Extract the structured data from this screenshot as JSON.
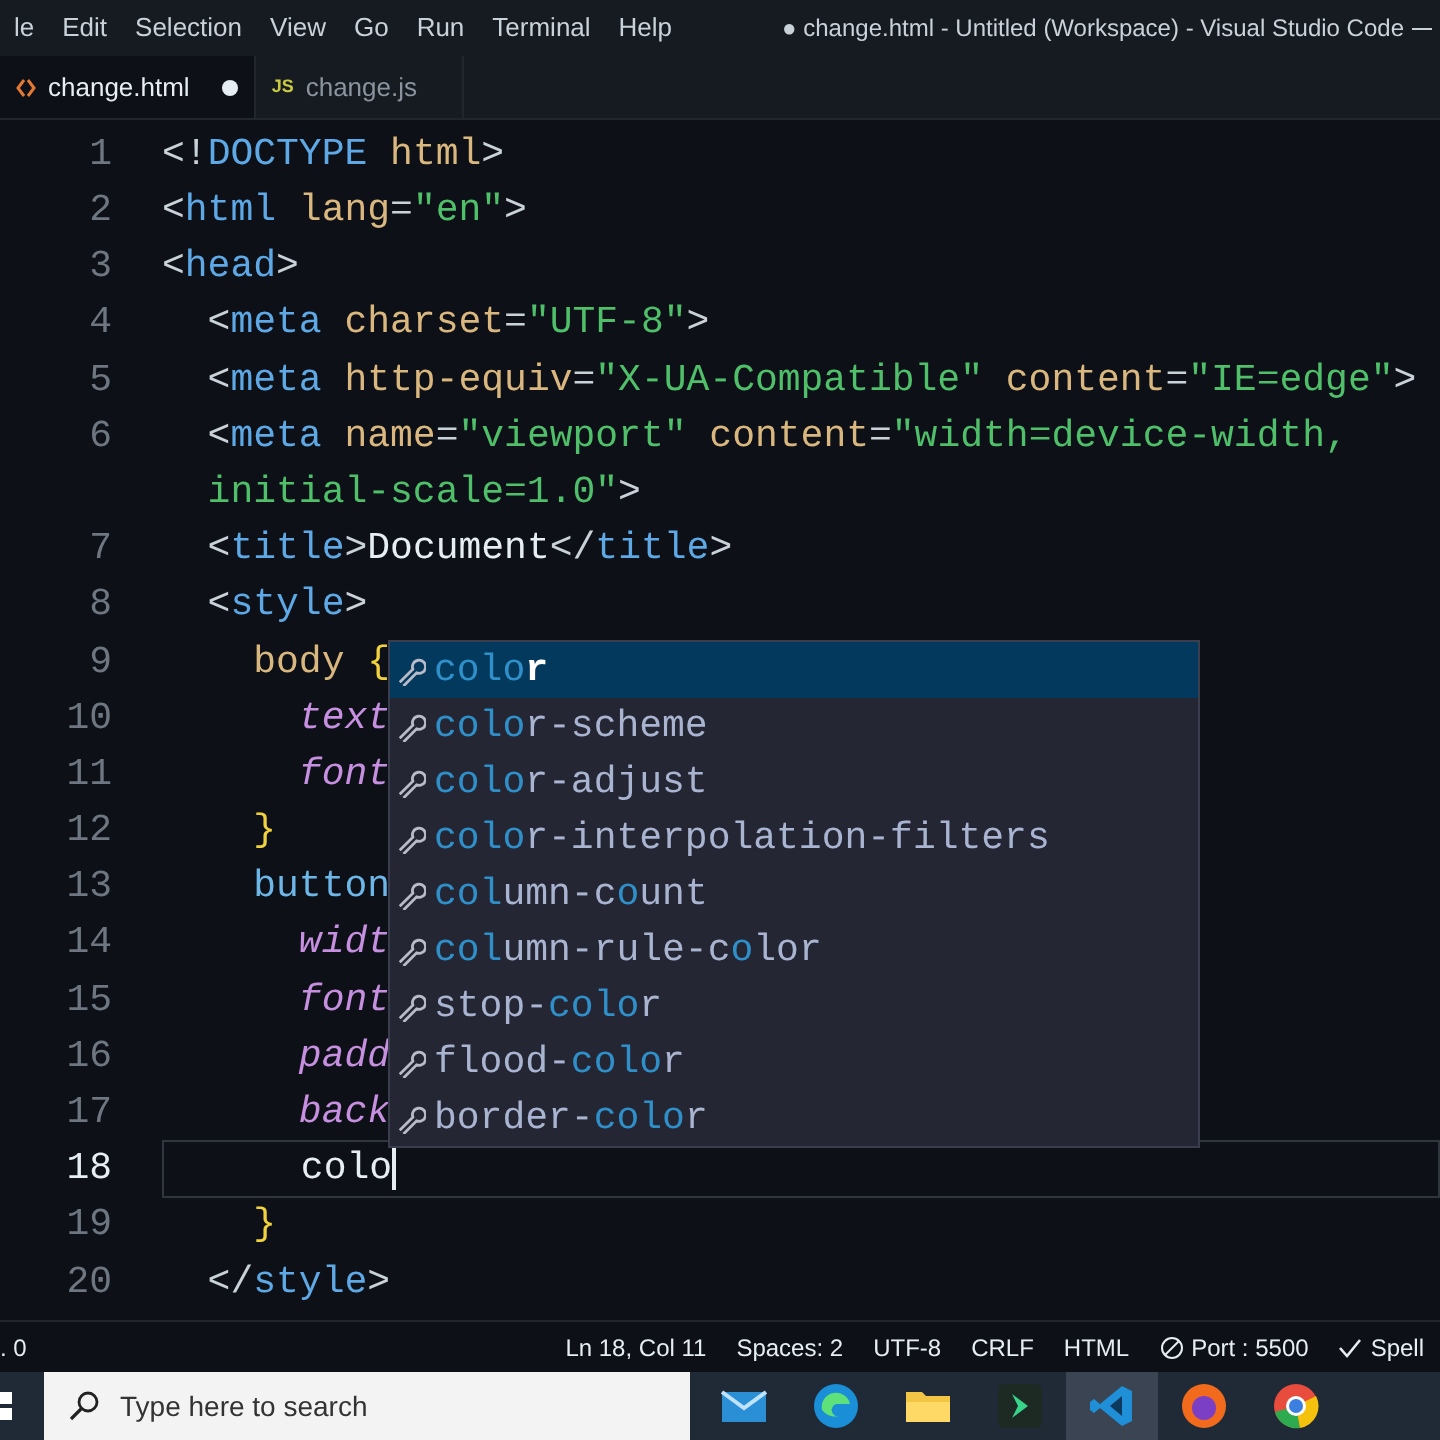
{
  "menu_bar": {
    "items": [
      "le",
      "Edit",
      "Selection",
      "View",
      "Go",
      "Run",
      "Terminal",
      "Help"
    ],
    "title": "● change.html - Untitled (Workspace) - Visual Studio Code"
  },
  "tabs": [
    {
      "label": "change.html",
      "kind": "html",
      "modified": true,
      "selected": true
    },
    {
      "label": "change.js",
      "kind": "js",
      "badge": "JS",
      "modified": false,
      "selected": false
    }
  ],
  "editor": {
    "lines": [
      {
        "number": "1",
        "current": false,
        "tokens": [
          {
            "text": "<!",
            "kind": "p"
          },
          {
            "text": "DOCTYPE",
            "kind": "tag"
          },
          {
            "text": " html",
            "kind": "attr"
          },
          {
            "text": ">",
            "kind": "p"
          }
        ]
      },
      {
        "number": "2",
        "current": false,
        "tokens": [
          {
            "text": "<",
            "kind": "p"
          },
          {
            "text": "html",
            "kind": "tag"
          },
          {
            "text": " lang",
            "kind": "attr"
          },
          {
            "text": "=",
            "kind": "p"
          },
          {
            "text": "\"en\"",
            "kind": "str"
          },
          {
            "text": ">",
            "kind": "p"
          }
        ]
      },
      {
        "number": "3",
        "current": false,
        "tokens": [
          {
            "text": "<",
            "kind": "p"
          },
          {
            "text": "head",
            "kind": "tag"
          },
          {
            "text": ">",
            "kind": "p"
          }
        ]
      },
      {
        "number": "4",
        "current": false,
        "tokens": [
          {
            "text": "  <",
            "kind": "p"
          },
          {
            "text": "meta",
            "kind": "tag"
          },
          {
            "text": " charset",
            "kind": "attr"
          },
          {
            "text": "=",
            "kind": "p"
          },
          {
            "text": "\"UTF-8\"",
            "kind": "str"
          },
          {
            "text": ">",
            "kind": "p"
          }
        ]
      },
      {
        "number": "5",
        "current": false,
        "tokens": [
          {
            "text": "  <",
            "kind": "p"
          },
          {
            "text": "meta",
            "kind": "tag"
          },
          {
            "text": " http-equiv",
            "kind": "attr"
          },
          {
            "text": "=",
            "kind": "p"
          },
          {
            "text": "\"X-UA-Compatible\"",
            "kind": "str"
          },
          {
            "text": " content",
            "kind": "attr"
          },
          {
            "text": "=",
            "kind": "p"
          },
          {
            "text": "\"IE=edge\"",
            "kind": "str"
          },
          {
            "text": ">",
            "kind": "p"
          }
        ]
      },
      {
        "number": "6",
        "current": false,
        "tokens": [
          {
            "text": "  <",
            "kind": "p"
          },
          {
            "text": "meta",
            "kind": "tag"
          },
          {
            "text": " name",
            "kind": "attr"
          },
          {
            "text": "=",
            "kind": "p"
          },
          {
            "text": "\"viewport\"",
            "kind": "str"
          },
          {
            "text": " content",
            "kind": "attr"
          },
          {
            "text": "=",
            "kind": "p"
          },
          {
            "text": "\"width=device-width,",
            "kind": "str"
          }
        ]
      },
      {
        "current": false,
        "tokens": [
          {
            "text": "  initial-scale=1.0\"",
            "kind": "str"
          },
          {
            "text": ">",
            "kind": "p"
          }
        ]
      },
      {
        "number": "7",
        "current": false,
        "tokens": [
          {
            "text": "  <",
            "kind": "p"
          },
          {
            "text": "title",
            "kind": "tag"
          },
          {
            "text": ">",
            "kind": "p"
          },
          {
            "text": "Document",
            "kind": "text"
          },
          {
            "text": "</",
            "kind": "p"
          },
          {
            "text": "title",
            "kind": "tag"
          },
          {
            "text": ">",
            "kind": "p"
          }
        ]
      },
      {
        "number": "8",
        "current": false,
        "tokens": [
          {
            "text": "  <",
            "kind": "p"
          },
          {
            "text": "style",
            "kind": "tag"
          },
          {
            "text": ">",
            "kind": "p"
          }
        ]
      },
      {
        "number": "9",
        "current": false,
        "tokens": [
          {
            "text": "    body",
            "kind": "sel"
          },
          {
            "text": " {",
            "kind": "brace"
          }
        ]
      },
      {
        "number": "10",
        "current": false,
        "tokens": [
          {
            "text": "      text",
            "kind": "prop"
          }
        ]
      },
      {
        "number": "11",
        "current": false,
        "tokens": [
          {
            "text": "      font",
            "kind": "prop"
          }
        ]
      },
      {
        "number": "12",
        "current": false,
        "tokens": [
          {
            "text": "    }",
            "kind": "brace"
          }
        ]
      },
      {
        "number": "13",
        "current": false,
        "tokens": [
          {
            "text": "    button",
            "kind": "sel2"
          }
        ]
      },
      {
        "number": "14",
        "current": false,
        "tokens": [
          {
            "text": "      widt",
            "kind": "prop"
          }
        ]
      },
      {
        "number": "15",
        "current": false,
        "tokens": [
          {
            "text": "      font",
            "kind": "prop"
          }
        ]
      },
      {
        "number": "16",
        "current": false,
        "tokens": [
          {
            "text": "      padd",
            "kind": "prop"
          }
        ]
      },
      {
        "number": "17",
        "current": false,
        "tokens": [
          {
            "text": "      back",
            "kind": "prop"
          }
        ]
      },
      {
        "number": "18",
        "current": true,
        "tokens": [
          {
            "text": "      colo",
            "kind": "text"
          }
        ]
      },
      {
        "number": "19",
        "current": false,
        "tokens": [
          {
            "text": "    }",
            "kind": "brace"
          }
        ]
      },
      {
        "number": "20",
        "current": false,
        "tokens": [
          {
            "text": "  </",
            "kind": "p"
          },
          {
            "text": "style",
            "kind": "tag"
          },
          {
            "text": ">",
            "kind": "p"
          }
        ]
      }
    ]
  },
  "suggestions": [
    {
      "selected": true,
      "parts": [
        {
          "text": "colo",
          "match": true
        },
        {
          "text": "r",
          "match": false
        }
      ]
    },
    {
      "selected": false,
      "parts": [
        {
          "text": "colo",
          "match": true
        },
        {
          "text": "r-scheme",
          "match": false
        }
      ]
    },
    {
      "selected": false,
      "parts": [
        {
          "text": "colo",
          "match": true
        },
        {
          "text": "r-adjust",
          "match": false
        }
      ]
    },
    {
      "selected": false,
      "parts": [
        {
          "text": "colo",
          "match": true
        },
        {
          "text": "r-interpolation-filters",
          "match": false
        }
      ]
    },
    {
      "selected": false,
      "parts": [
        {
          "text": "col",
          "match": true
        },
        {
          "text": "umn-c",
          "match": false
        },
        {
          "text": "o",
          "match": true
        },
        {
          "text": "unt",
          "match": false
        }
      ]
    },
    {
      "selected": false,
      "parts": [
        {
          "text": "col",
          "match": true
        },
        {
          "text": "umn-rule-c",
          "match": false
        },
        {
          "text": "o",
          "match": true
        },
        {
          "text": "lor",
          "match": false
        }
      ]
    },
    {
      "selected": false,
      "parts": [
        {
          "text": "stop-",
          "match": false
        },
        {
          "text": "colo",
          "match": true
        },
        {
          "text": "r",
          "match": false
        }
      ]
    },
    {
      "selected": false,
      "parts": [
        {
          "text": "flood-",
          "match": false
        },
        {
          "text": "colo",
          "match": true
        },
        {
          "text": "r",
          "match": false
        }
      ]
    },
    {
      "selected": false,
      "parts": [
        {
          "text": "border-",
          "match": false
        },
        {
          "text": "colo",
          "match": true
        },
        {
          "text": "r",
          "match": false
        }
      ]
    }
  ],
  "status_bar": {
    "left": ". 0",
    "items": [
      {
        "label": "Ln 18, Col 11",
        "kind": "text"
      },
      {
        "label": "Spaces: 2",
        "kind": "text"
      },
      {
        "label": "UTF-8",
        "kind": "text"
      },
      {
        "label": "CRLF",
        "kind": "text"
      },
      {
        "label": "HTML",
        "kind": "text"
      },
      {
        "label": "Port : 5500",
        "kind": "port"
      },
      {
        "label": "Spell",
        "kind": "check"
      }
    ]
  },
  "taskbar": {
    "search": {
      "placeholder": "Type here to search"
    },
    "apps": [
      {
        "kind": "mail",
        "selected": false
      },
      {
        "kind": "edge",
        "selected": false
      },
      {
        "kind": "folder",
        "selected": false
      },
      {
        "kind": "arrow",
        "selected": false
      },
      {
        "kind": "code",
        "selected": true
      },
      {
        "kind": "fox",
        "selected": false
      },
      {
        "kind": "chrome",
        "selected": false
      }
    ]
  }
}
